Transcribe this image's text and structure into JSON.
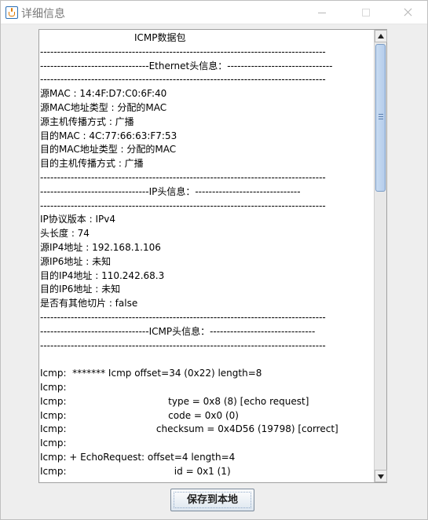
{
  "window": {
    "title": "详细信息",
    "minimize_label": "–",
    "maximize_label": "□",
    "close_label": "✕"
  },
  "report": {
    "lines": [
      {
        "text": "ICMP数据包",
        "heading": true
      },
      {
        "text": "------------------------------------------------------------------------------------"
      },
      {
        "text": "--------------------------------Ethernet头信息：-------------------------------"
      },
      {
        "text": "------------------------------------------------------------------------------------"
      },
      {
        "text": "源MAC : 14:4F:D7:C0:6F:40"
      },
      {
        "text": "源MAC地址类型 : 分配的MAC"
      },
      {
        "text": "源主机传播方式 : 广播"
      },
      {
        "text": "目的MAC : 4C:77:66:63:F7:53"
      },
      {
        "text": "目的MAC地址类型 : 分配的MAC"
      },
      {
        "text": "目的主机传播方式 : 广播"
      },
      {
        "text": "------------------------------------------------------------------------------------"
      },
      {
        "text": "--------------------------------IP头信息：-------------------------------"
      },
      {
        "text": "------------------------------------------------------------------------------------"
      },
      {
        "text": "IP协议版本 : IPv4"
      },
      {
        "text": "头长度 : 74"
      },
      {
        "text": "源IP4地址 : 192.168.1.106"
      },
      {
        "text": "源IP6地址 : 未知"
      },
      {
        "text": "目的IP4地址 : 110.242.68.3"
      },
      {
        "text": "目的IP6地址 : 未知"
      },
      {
        "text": "是否有其他切片 : false"
      },
      {
        "text": "------------------------------------------------------------------------------------"
      },
      {
        "text": "--------------------------------ICMP头信息：-------------------------------"
      },
      {
        "text": "------------------------------------------------------------------------------------"
      },
      {
        "text": ""
      },
      {
        "text": "Icmp:  ******* Icmp offset=34 (0x22) length=8"
      },
      {
        "text": "Icmp:"
      },
      {
        "text": "Icmp:                                  type = 0x8 (8) [echo request]"
      },
      {
        "text": "Icmp:                                  code = 0x0 (0)"
      },
      {
        "text": "Icmp:                              checksum = 0x4D56 (19798) [correct]"
      },
      {
        "text": "Icmp:"
      },
      {
        "text": "Icmp: + EchoRequest: offset=4 length=4"
      },
      {
        "text": "Icmp:                                    id = 0x1 (1)"
      }
    ]
  },
  "scrollbar": {
    "position_fraction": 0.0,
    "visible_fraction": 0.35
  },
  "actions": {
    "save_label": "保存到本地"
  },
  "colors": {
    "thumb": "#b4cceb",
    "panel_bg": "#eeeeee"
  }
}
